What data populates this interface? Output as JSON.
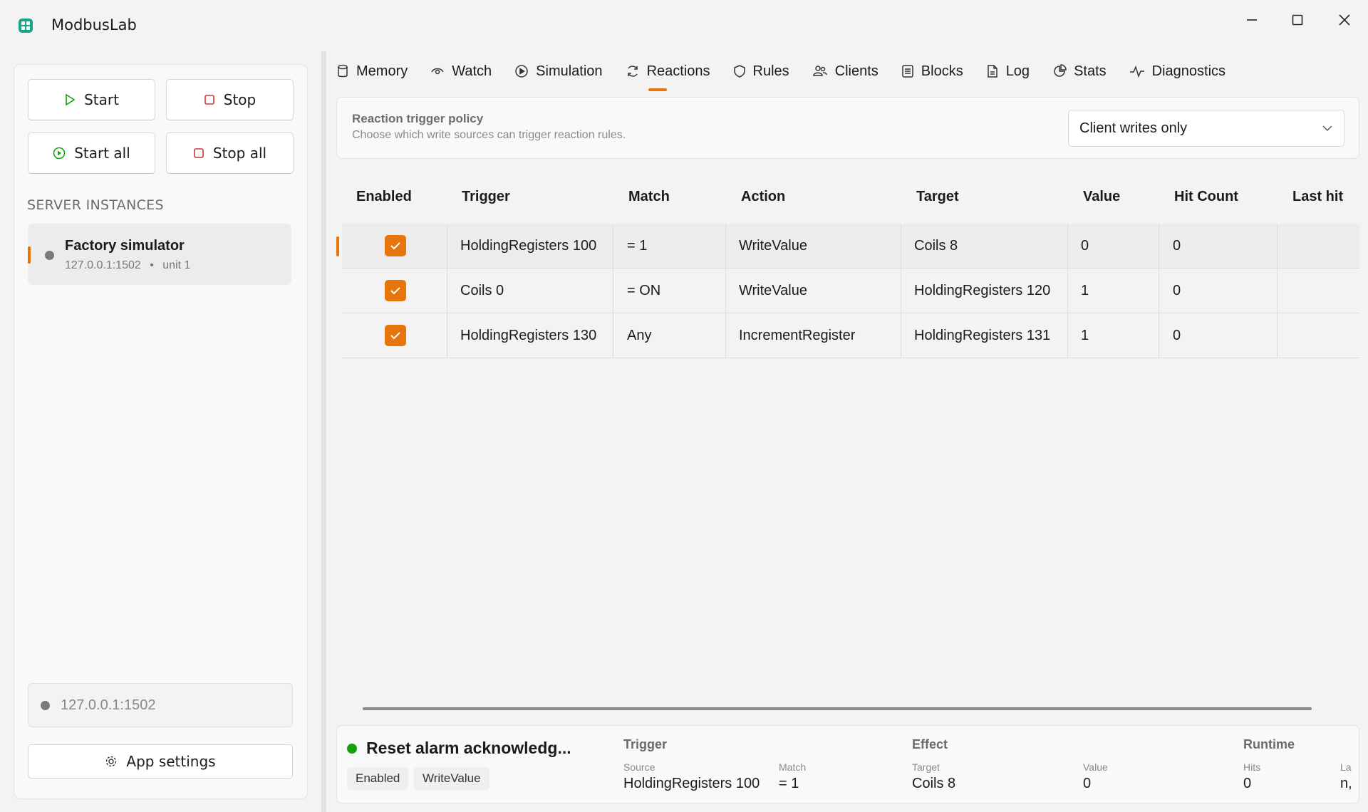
{
  "app": {
    "title": "ModbusLab"
  },
  "sidebar": {
    "buttons": {
      "start": "Start",
      "stop": "Stop",
      "start_all": "Start all",
      "stop_all": "Stop all"
    },
    "section_label": "SERVER INSTANCES",
    "instance": {
      "name": "Factory simulator",
      "address": "127.0.0.1:1502",
      "unit": "unit 1"
    },
    "address_box": "127.0.0.1:1502",
    "settings_label": "App settings"
  },
  "tabs": [
    {
      "label": "Memory",
      "icon": "database-icon"
    },
    {
      "label": "Watch",
      "icon": "eye-icon"
    },
    {
      "label": "Simulation",
      "icon": "play-circle-icon"
    },
    {
      "label": "Reactions",
      "icon": "refresh-icon",
      "active": true
    },
    {
      "label": "Rules",
      "icon": "shield-icon"
    },
    {
      "label": "Clients",
      "icon": "people-icon"
    },
    {
      "label": "Blocks",
      "icon": "list-box-icon"
    },
    {
      "label": "Log",
      "icon": "document-icon"
    },
    {
      "label": "Stats",
      "icon": "stats-icon"
    },
    {
      "label": "Diagnostics",
      "icon": "pulse-icon"
    }
  ],
  "policy": {
    "title": "Reaction trigger policy",
    "subtitle": "Choose which write sources can trigger reaction rules.",
    "selected": "Client writes only"
  },
  "table": {
    "columns": [
      "Enabled",
      "Trigger",
      "Match",
      "Action",
      "Target",
      "Value",
      "Hit Count",
      "Last hit"
    ],
    "rows": [
      {
        "enabled": true,
        "trigger": "HoldingRegisters 100",
        "match": "= 1",
        "action": "WriteValue",
        "target": "Coils 8",
        "value": "0",
        "hits": "0",
        "last": ""
      },
      {
        "enabled": true,
        "trigger": "Coils 0",
        "match": "= ON",
        "action": "WriteValue",
        "target": "HoldingRegisters 120",
        "value": "1",
        "hits": "0",
        "last": ""
      },
      {
        "enabled": true,
        "trigger": "HoldingRegisters 130",
        "match": "Any",
        "action": "IncrementRegister",
        "target": "HoldingRegisters 131",
        "value": "1",
        "hits": "0",
        "last": ""
      }
    ]
  },
  "detail": {
    "name": "Reset alarm acknowledg...",
    "chips": [
      "Enabled",
      "WriteValue"
    ],
    "trigger_heading": "Trigger",
    "source_label": "Source",
    "source": "HoldingRegisters 100",
    "match_label": "Match",
    "match": "= 1",
    "effect_heading": "Effect",
    "target_label": "Target",
    "target": "Coils 8",
    "value_label": "Value",
    "value": "0",
    "runtime_heading": "Runtime",
    "hits_label": "Hits",
    "hits": "0",
    "last_label": "La",
    "last": "n,"
  },
  "colors": {
    "accent": "#e6760c",
    "brand": "#1aa38a",
    "status_ok": "#13a10e",
    "status_idle": "#7a7a7a"
  }
}
